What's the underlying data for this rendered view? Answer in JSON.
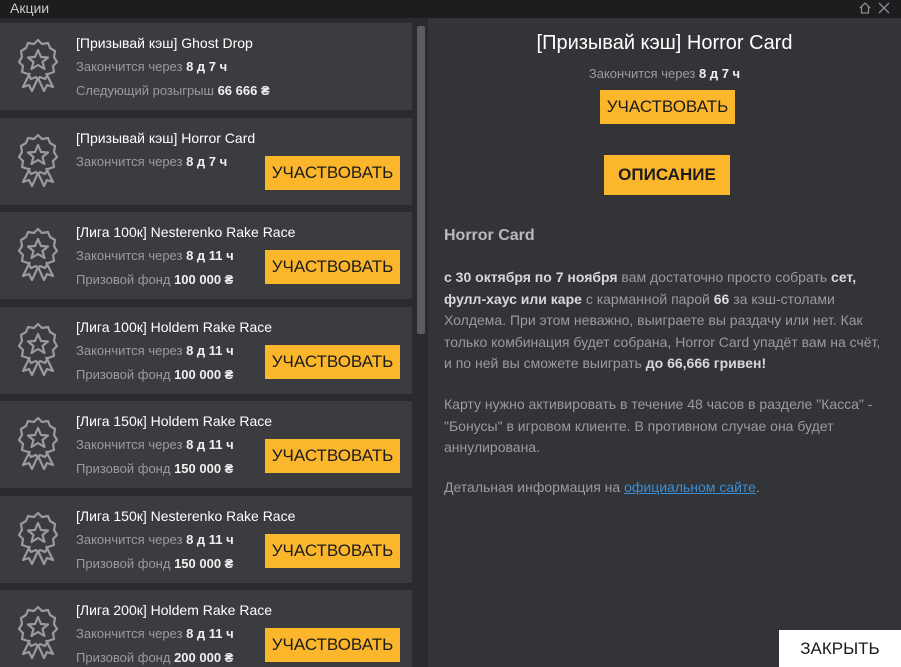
{
  "window": {
    "title": "Акции",
    "home_icon": "home-icon",
    "close_icon": "close-icon"
  },
  "colors": {
    "accent": "#fbb62b",
    "card": "#3b3c40",
    "panel": "#333437",
    "link": "#3a8fd6"
  },
  "promotions": [
    {
      "name": "[Призывай кэш] Ghost Drop",
      "ends_label": "Закончится через",
      "ends_value": "8 д 7 ч",
      "extra_label": "Следующий розыгрыш",
      "extra_value": "66 666 ₴",
      "button": ""
    },
    {
      "name": "[Призывай кэш] Horror Card",
      "ends_label": "Закончится через",
      "ends_value": "8 д 7 ч",
      "extra_label": "",
      "extra_value": "",
      "button": "УЧАСТВОВАТЬ"
    },
    {
      "name": "[Лига 100к] Nesterenko Rake Race",
      "ends_label": "Закончится через",
      "ends_value": "8 д 11 ч",
      "extra_label": "Призовой фонд",
      "extra_value": "100 000 ₴",
      "button": "УЧАСТВОВАТЬ"
    },
    {
      "name": "[Лига 100к] Holdem Rake Race",
      "ends_label": "Закончится через",
      "ends_value": "8 д 11 ч",
      "extra_label": "Призовой фонд",
      "extra_value": "100 000 ₴",
      "button": "УЧАСТВОВАТЬ"
    },
    {
      "name": "[Лига 150к] Holdem Rake Race",
      "ends_label": "Закончится через",
      "ends_value": "8 д 11 ч",
      "extra_label": "Призовой фонд",
      "extra_value": "150 000 ₴",
      "button": "УЧАСТВОВАТЬ"
    },
    {
      "name": "[Лига 150к] Nesterenko Rake Race",
      "ends_label": "Закончится через",
      "ends_value": "8 д 11 ч",
      "extra_label": "Призовой фонд",
      "extra_value": "150 000 ₴",
      "button": "УЧАСТВОВАТЬ"
    },
    {
      "name": "[Лига 200к] Holdem Rake Race",
      "ends_label": "Закончится через",
      "ends_value": "8 д 11 ч",
      "extra_label": "Призовой фонд",
      "extra_value": "200 000 ₴",
      "button": "УЧАСТВОВАТЬ"
    }
  ],
  "detail": {
    "title": "[Призывай кэш] Horror Card",
    "ends_label": "Закончится через",
    "ends_value": "8 д 7 ч",
    "join_button": "УЧАСТВОВАТЬ",
    "description_button": "ОПИСАНИЕ",
    "heading": "Horror Card",
    "p1": {
      "b1": "с 30 октября по 7 ноября",
      "t1": " вам достаточно просто собрать ",
      "b2": "сет, фулл-хаус или каре",
      "t2": " с карманной парой ",
      "b3": "66",
      "t3": " за кэш-столами Холдема. При этом неважно, выиграете вы раздачу или нет. Как только комбинация будет собрана, Horror Card упадёт вам на счёт, и по ней вы сможете выиграть ",
      "b4": "до 66,666 гривен!"
    },
    "p2": "Карту нужно активировать в течение 48 часов в разделе \"Касса\" - \"Бонусы\" в игровом клиенте. В противном случае она будет аннулирована.",
    "p3": {
      "before": "Детальная информация на ",
      "link": "официальном сайте",
      "after": "."
    }
  },
  "footer": {
    "close_button": "ЗАКРЫТЬ"
  }
}
